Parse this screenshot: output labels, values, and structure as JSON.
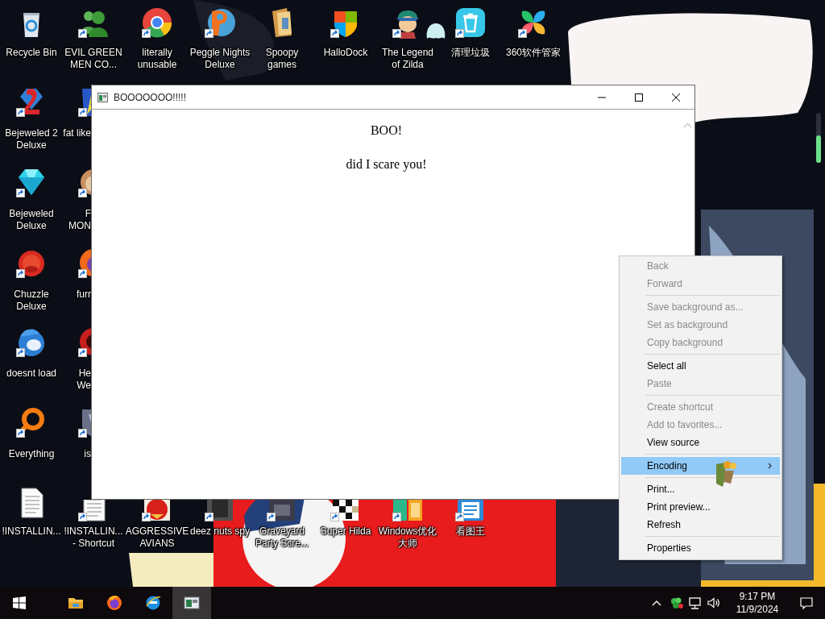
{
  "desktop_icons": [
    {
      "label": [
        "Recycle Bin"
      ],
      "shortcut": false
    },
    {
      "label": [
        "EVIL GREEN",
        "MEN CO..."
      ],
      "shortcut": true
    },
    {
      "label": [
        "literally",
        "unusable"
      ],
      "shortcut": true
    },
    {
      "label": [
        "Peggle Nights",
        "Deluxe"
      ],
      "shortcut": true
    },
    {
      "label": [
        "Spoopy",
        "games"
      ],
      "shortcut": false
    },
    {
      "label": [
        "HalloDock"
      ],
      "shortcut": true
    },
    {
      "label": [
        "The Legend",
        "of Zilda"
      ],
      "shortcut": true
    },
    {
      "label": [
        "清理垃圾"
      ],
      "shortcut": true
    },
    {
      "label": [
        "360软件管家"
      ],
      "shortcut": true
    },
    {
      "label": [
        "Bejeweled 2",
        "Deluxe"
      ],
      "shortcut": true
    },
    {
      "label": [
        "Bejeweled",
        "Deluxe"
      ],
      "shortcut": true
    },
    {
      "label": [
        "Chuzzle",
        "Deluxe"
      ],
      "shortcut": true
    },
    {
      "label": [
        "doesnt load"
      ],
      "shortcut": true
    },
    {
      "label": [
        "Everything"
      ],
      "shortcut": true
    },
    {
      "label": [
        "fat like"
      ],
      "shortcut": true
    },
    {
      "label": [
        "F",
        "MON"
      ],
      "shortcut": true
    },
    {
      "label": [
        "furr"
      ],
      "shortcut": true
    },
    {
      "label": [
        "He",
        "We"
      ],
      "shortcut": true
    },
    {
      "label": [
        "is"
      ],
      "shortcut": true
    },
    {
      "label": [
        "!INSTALLIN..."
      ],
      "shortcut": false
    },
    {
      "label": [
        "!INSTALLIN...",
        "- Shortcut"
      ],
      "shortcut": true
    },
    {
      "label": [
        "AGGRESSIVE",
        "AVIANS"
      ],
      "shortcut": true
    },
    {
      "label": [
        "deez nuts spy"
      ],
      "shortcut": true
    },
    {
      "label": [
        "Graveyard",
        "Party Scre..."
      ],
      "shortcut": true
    },
    {
      "label": [
        "Super Hilda"
      ],
      "shortcut": true
    },
    {
      "label": [
        "Windows优化",
        "大师"
      ],
      "shortcut": true
    },
    {
      "label": [
        "看图王"
      ],
      "shortcut": true
    }
  ],
  "window": {
    "title": "BOOOOOOO!!!!!",
    "heading": "BOO!",
    "message": "did I scare you!"
  },
  "context_menu": {
    "groups": [
      [
        {
          "label": "Back",
          "disabled": true,
          "selected": false,
          "submenu": false
        },
        {
          "label": "Forward",
          "disabled": true,
          "selected": false,
          "submenu": false
        }
      ],
      [
        {
          "label": "Save background as...",
          "disabled": true,
          "selected": false,
          "submenu": false
        },
        {
          "label": "Set as background",
          "disabled": true,
          "selected": false,
          "submenu": false
        },
        {
          "label": "Copy background",
          "disabled": true,
          "selected": false,
          "submenu": false
        }
      ],
      [
        {
          "label": "Select all",
          "disabled": false,
          "selected": false,
          "submenu": false
        },
        {
          "label": "Paste",
          "disabled": true,
          "selected": false,
          "submenu": false
        }
      ],
      [
        {
          "label": "Create shortcut",
          "disabled": true,
          "selected": false,
          "submenu": false
        },
        {
          "label": "Add to favorites...",
          "disabled": true,
          "selected": false,
          "submenu": false
        },
        {
          "label": "View source",
          "disabled": false,
          "selected": false,
          "submenu": false
        }
      ],
      [
        {
          "label": "Encoding",
          "disabled": false,
          "selected": true,
          "submenu": true
        }
      ],
      [
        {
          "label": "Print...",
          "disabled": false,
          "selected": false,
          "submenu": false
        },
        {
          "label": "Print preview...",
          "disabled": false,
          "selected": false,
          "submenu": false
        },
        {
          "label": "Refresh",
          "disabled": false,
          "selected": false,
          "submenu": false
        }
      ],
      [
        {
          "label": "Properties",
          "disabled": false,
          "selected": false,
          "submenu": false
        }
      ]
    ]
  },
  "taskbar": {
    "apps": [
      {
        "selected": false
      },
      {
        "selected": false
      },
      {
        "selected": false
      },
      {
        "selected": true
      }
    ],
    "clock": {
      "time": "9:17 PM",
      "date": "11/9/2024"
    }
  }
}
